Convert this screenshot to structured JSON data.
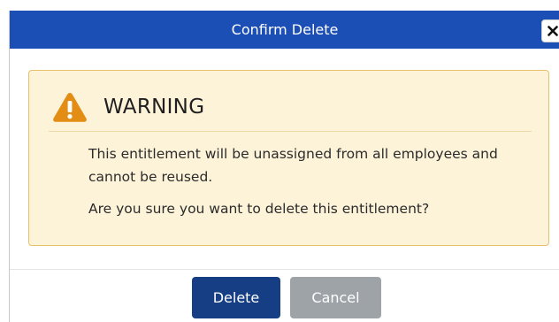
{
  "dialog": {
    "title": "Confirm Delete",
    "close_icon": "close-icon",
    "colors": {
      "header": "#1b4fb6",
      "warning_bg": "#fdf3d9",
      "warning_border": "#e8c06a",
      "warning_icon": "#e38d14",
      "primary_button": "#163e85",
      "secondary_button": "#9ea3a7"
    }
  },
  "warning": {
    "icon": "warning-triangle-icon",
    "title": "WARNING",
    "message": "This entitlement will be unassigned from all employees and cannot be reused.",
    "question": "Are you sure you want to delete this entitlement?"
  },
  "buttons": {
    "delete_label": "Delete",
    "cancel_label": "Cancel"
  }
}
